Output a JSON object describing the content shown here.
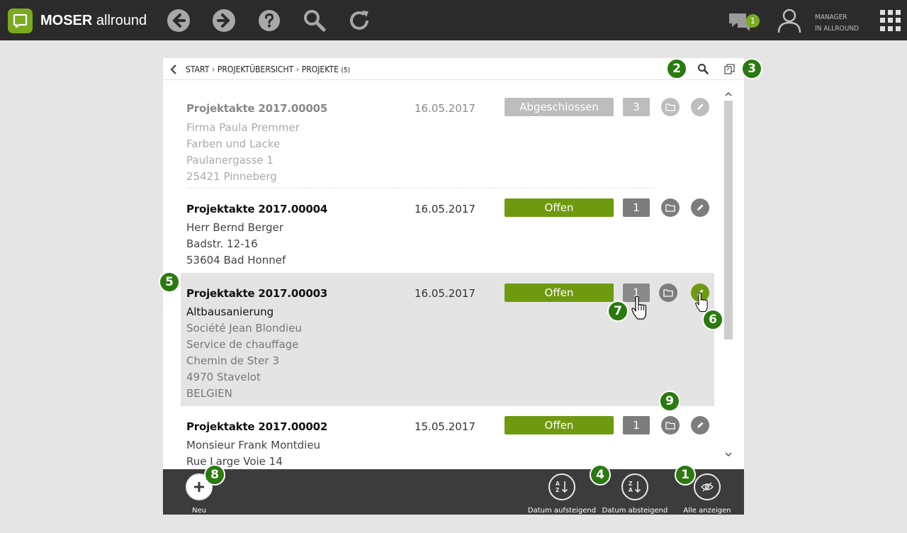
{
  "app": {
    "brand_bold": "MOSER",
    "brand_rest": "allround",
    "notifications_count": "1",
    "user_line1": "MANAGER",
    "user_line2": "IN ALLROUND",
    "accent_color": "#7aaa20"
  },
  "breadcrumb": {
    "items": [
      "START",
      "PROJEKTÜBERSICHT",
      "PROJEKTE"
    ],
    "count": "(5)"
  },
  "rows": [
    {
      "title": "Projektakte 2017.00005",
      "date": "16.05.2017",
      "status": "Abgeschlossen",
      "status_color": "#bdbdbd",
      "count": "3",
      "main_line": "",
      "lines": [
        "Firma Paula Premmer",
        "Farben und Lacke",
        "Paulanergasse 1",
        "25421 Pinneberg"
      ]
    },
    {
      "title": "Projektakte 2017.00004",
      "date": "16.05.2017",
      "status": "Offen",
      "status_color": "#6f9a10",
      "count": "1",
      "main_line": "",
      "lines": [
        "Herr Bernd Berger",
        "Badstr. 12-16",
        "53604 Bad Honnef"
      ]
    },
    {
      "title": "Projektakte 2017.00003",
      "date": "16.05.2017",
      "status": "Offen",
      "status_color": "#6f9a10",
      "count": "1",
      "main_line": "Altbausanierung",
      "lines": [
        "Société Jean Blondieu",
        "Service de chauffage",
        "Chemin de Ster 3",
        "4970 Stavelot",
        "BELGIEN"
      ]
    },
    {
      "title": "Projektakte 2017.00002",
      "date": "15.05.2017",
      "status": "Offen",
      "status_color": "#6f9a10",
      "count": "1",
      "main_line": "",
      "lines": [
        "Monsieur Frank Montdieu",
        "Rue Large Voie 14"
      ]
    }
  ],
  "bottom": {
    "new_label": "Neu",
    "sort_asc_label": "Datum aufsteigend",
    "sort_desc_label": "Datum absteigend",
    "show_all_label": "Alle anzeigen"
  },
  "callouts": [
    "1",
    "2",
    "3",
    "4",
    "5",
    "6",
    "7",
    "8",
    "9"
  ],
  "icons": [
    "back-icon",
    "forward-icon",
    "help-icon",
    "search-icon",
    "refresh-icon",
    "chat-icon",
    "user-icon",
    "apps-grid-icon",
    "folder-icon",
    "pencil-icon",
    "copy-icon",
    "plus-icon",
    "sort-az-icon",
    "sort-za-icon",
    "eye-slash-icon"
  ]
}
